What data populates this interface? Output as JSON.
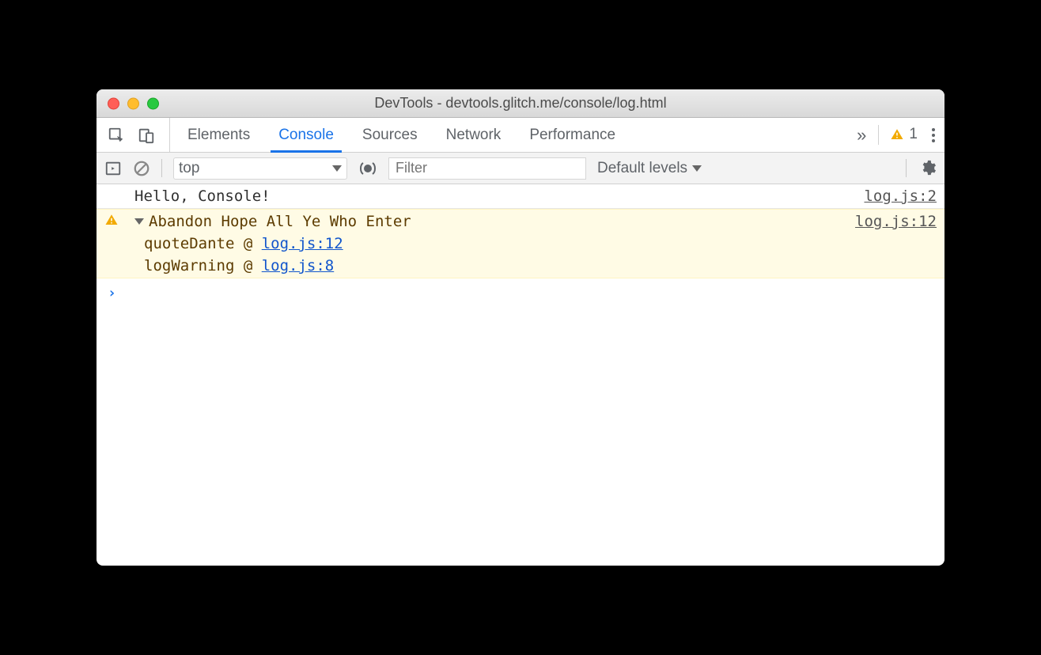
{
  "window": {
    "title": "DevTools - devtools.glitch.me/console/log.html"
  },
  "tabs": {
    "items": [
      "Elements",
      "Console",
      "Sources",
      "Network",
      "Performance"
    ],
    "active_index": 1,
    "overflow_glyph": "»"
  },
  "status": {
    "warning_count": "1"
  },
  "filterbar": {
    "context": "top",
    "filter_placeholder": "Filter",
    "levels_label": "Default levels"
  },
  "logs": [
    {
      "type": "log",
      "message": "Hello, Console!",
      "source": "log.js:2"
    },
    {
      "type": "warning",
      "message": "Abandon Hope All Ye Who Enter",
      "source": "log.js:12",
      "expanded": true,
      "stack": [
        {
          "fn": "quoteDante",
          "sep": " @ ",
          "loc": "log.js:12"
        },
        {
          "fn": "logWarning",
          "sep": " @ ",
          "loc": "log.js:8"
        }
      ]
    }
  ],
  "prompt": {
    "glyph": "›"
  }
}
